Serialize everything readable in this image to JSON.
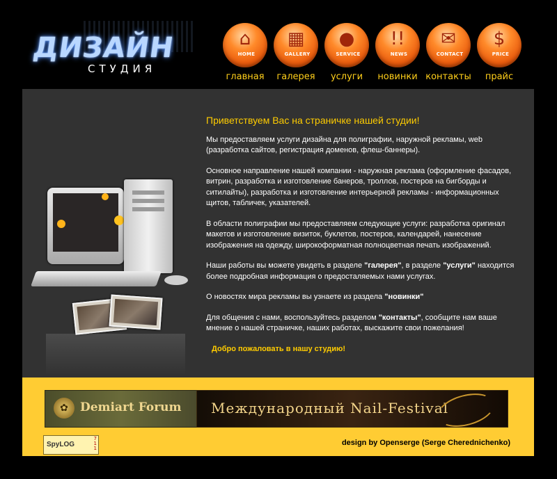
{
  "logo": {
    "title": "ДИЗАЙН",
    "subtitle": "СТУДИЯ"
  },
  "nav": [
    {
      "caption": "HOME",
      "label": "главная",
      "icon": "home-icon",
      "glyph": "⌂"
    },
    {
      "caption": "GALLERY",
      "label": "галерея",
      "icon": "film-icon",
      "glyph": "▦"
    },
    {
      "caption": "SERVICE",
      "label": "услуги",
      "icon": "people-icon",
      "glyph": "●"
    },
    {
      "caption": "NEWS",
      "label": "новинки",
      "icon": "exclamation-icon",
      "glyph": "!!"
    },
    {
      "caption": "CONTACT",
      "label": "контакты",
      "icon": "envelope-icon",
      "glyph": "✉"
    },
    {
      "caption": "PRICE",
      "label": "прайс",
      "icon": "dollar-icon",
      "glyph": "$"
    }
  ],
  "content": {
    "headline": "Приветствуем Вас на страничке нашей студии!",
    "p1": "Мы предоставляем услуги дизайна для полиграфии, наружной рекламы, web (разработка сайтов, регистрация доменов, флеш-баннеры).",
    "p2": "Основное направление нашей компании - наружная реклама (оформление фасадов, витрин, разработка и изготовление банеров, троллов, постеров на бигборды и ситилайты), разработка и изготовление интерьерной рекламы - информационных щитов, табличек, указателей.",
    "p3": "В области полиграфии мы предоставляем следующие услуги: разработка оригинал макетов и изготовление визиток, буклетов, постеров, календарей, нанесение изображения на одежду, широкоформатная полноцветная печать изображений.",
    "p4_a": "Наши работы вы можете увидеть в разделе ",
    "p4_b": "\"галерея\"",
    "p4_c": ", в разделе ",
    "p4_d": "\"услуги\"",
    "p4_e": " находится более подробная информация о предосталяемых нами услугах.",
    "p5_a": "О новостях мира рекламы вы узнаете из раздела ",
    "p5_b": "\"новинки\"",
    "p6_a": "Для общения с нами, воспользуйтесь разделом ",
    "p6_b": "\"контакты\"",
    "p6_c": ", сообщите нам ваше мнение о нашей страничке, наших работах, выскажите свои пожелания!",
    "welcome": "Добро пожаловать в нашу студию!"
  },
  "footer": {
    "banner1": "Demiart Forum",
    "banner2": "Международный Nail-Festival",
    "counter_logo": "SpyLOG",
    "counter_nums": [
      "7",
      "1",
      "1"
    ],
    "credit": "design by Openserge (Serge Cherednichenko)"
  },
  "colors": {
    "accent": "#ffcc00",
    "panel": "#323232",
    "footer": "#ffcc33",
    "nav_orange": "#ff8a2a"
  }
}
